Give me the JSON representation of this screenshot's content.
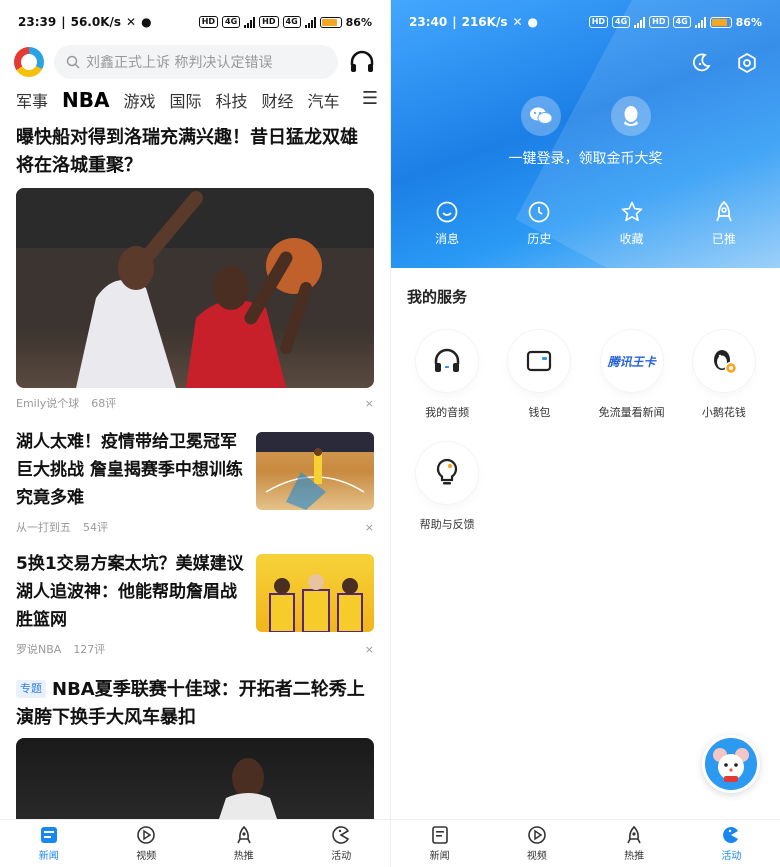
{
  "left": {
    "status": {
      "time": "23:39",
      "speed": "56.0K/s",
      "hd1": "HD",
      "net1": "4G",
      "hd2": "HD",
      "net2": "4G",
      "battery": "86%"
    },
    "search": {
      "placeholder": "刘鑫正式上诉 称判决认定错误"
    },
    "channels": [
      "军事",
      "NBA",
      "游戏",
      "国际",
      "科技",
      "财经",
      "汽车"
    ],
    "active_channel": "NBA",
    "feed": [
      {
        "title": "曝快船对得到洛瑞充满兴趣！昔日猛龙双雄将在洛城重聚？",
        "source": "Emily说个球",
        "comments": "68评"
      },
      {
        "title": "湖人太难！疫情带给卫冕冠军巨大挑战 詹皇揭赛季中想训练究竟多难",
        "source": "从一打到五",
        "comments": "54评"
      },
      {
        "title": "5换1交易方案太坑？美媒建议湖人追波神：他能帮助詹眉战胜篮网",
        "source": "罗说NBA",
        "comments": "127评"
      },
      {
        "tag": "专题",
        "title": "NBA夏季联赛十佳球：开拓者二轮秀上演胯下换手大风车暴扣"
      }
    ],
    "close_glyph": "×",
    "bottom_nav": [
      {
        "label": "新闻",
        "icon": "news-icon",
        "active": true
      },
      {
        "label": "视频",
        "icon": "video-play-icon"
      },
      {
        "label": "热推",
        "icon": "rocket-icon"
      },
      {
        "label": "活动",
        "icon": "pacman-icon"
      }
    ]
  },
  "right": {
    "status": {
      "time": "23:40",
      "speed": "216K/s",
      "hd1": "HD",
      "net1": "4G",
      "hd2": "HD",
      "net2": "4G",
      "battery": "86%"
    },
    "login_text": "一键登录，领取金币大奖",
    "hero_tabs": [
      {
        "label": "消息",
        "icon": "message-smile-icon"
      },
      {
        "label": "历史",
        "icon": "clock-icon"
      },
      {
        "label": "收藏",
        "icon": "star-icon"
      },
      {
        "label": "已推",
        "icon": "rocket-icon"
      }
    ],
    "services_title": "我的服务",
    "services": [
      {
        "label": "我的音频",
        "icon": "headphone-icon"
      },
      {
        "label": "钱包",
        "icon": "wallet-icon"
      },
      {
        "label": "免流量看新闻",
        "icon": "wangka-logo",
        "logo_text": "腾讯王卡"
      },
      {
        "label": "小鹅花钱",
        "icon": "penguin-coin-icon"
      },
      {
        "label": "帮助与反馈",
        "icon": "lightbulb-icon"
      }
    ],
    "bottom_nav": [
      {
        "label": "新闻",
        "icon": "news-icon"
      },
      {
        "label": "视频",
        "icon": "video-play-icon"
      },
      {
        "label": "热推",
        "icon": "rocket-icon"
      },
      {
        "label": "活动",
        "icon": "pacman-icon",
        "active": true
      }
    ]
  },
  "colors": {
    "accent": "#1a86f0",
    "hero_start": "#43a7ff",
    "hero_end": "#1c7fe6",
    "tag_bg": "#e8f1fd"
  }
}
